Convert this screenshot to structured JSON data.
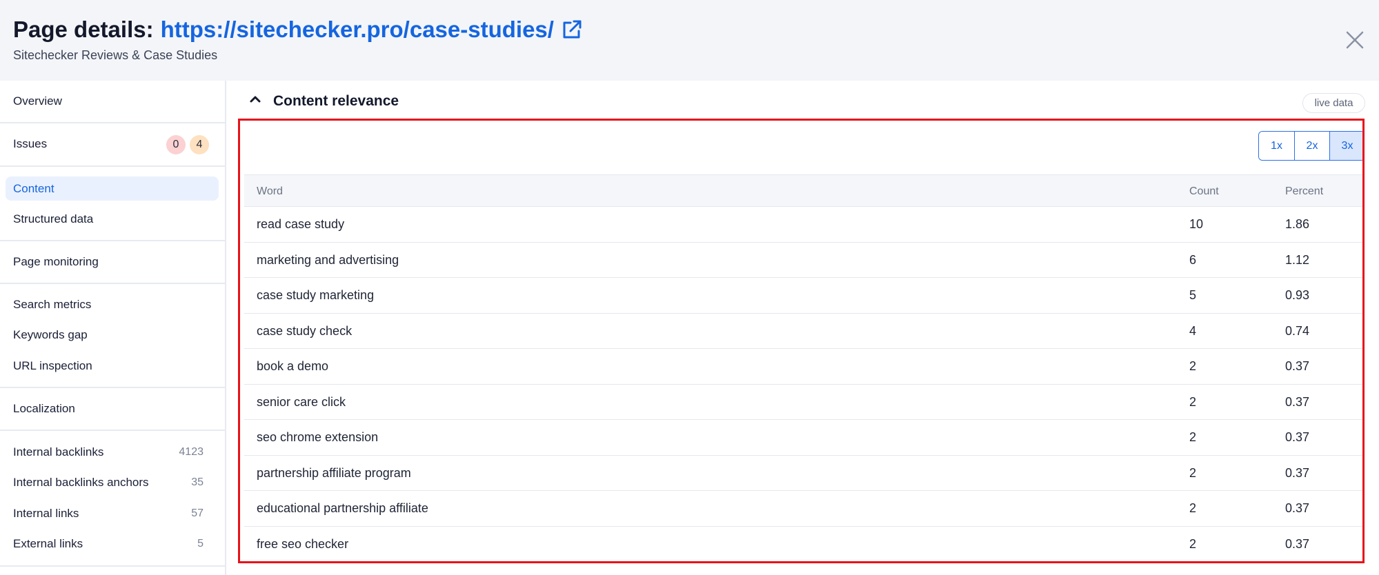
{
  "header": {
    "title_label": "Page details:",
    "url": "https://sitechecker.pro/case-studies/",
    "subtitle": "Sitechecker Reviews & Case Studies",
    "external_icon": "external-link-icon",
    "close_icon": "close-icon"
  },
  "sidebar": {
    "overview": "Overview",
    "issues": {
      "label": "Issues",
      "errors": "0",
      "warnings": "4"
    },
    "content": "Content",
    "structured_data": "Structured data",
    "page_monitoring": "Page monitoring",
    "search_metrics": "Search metrics",
    "keywords_gap": "Keywords gap",
    "url_inspection": "URL inspection",
    "localization": "Localization",
    "internal_backlinks": {
      "label": "Internal backlinks",
      "count": "4123"
    },
    "internal_backlinks_anchors": {
      "label": "Internal backlinks anchors",
      "count": "35"
    },
    "internal_links": {
      "label": "Internal links",
      "count": "57"
    },
    "external_links": {
      "label": "External links",
      "count": "5"
    }
  },
  "section": {
    "title": "Content relevance",
    "badge": "live data",
    "chevron_icon": "chevron-up-icon"
  },
  "ngram": {
    "options": [
      "1x",
      "2x",
      "3x"
    ],
    "selected": "3x"
  },
  "table": {
    "headers": {
      "word": "Word",
      "count": "Count",
      "percent": "Percent"
    },
    "rows": [
      {
        "word": "read case study",
        "count": "10",
        "percent": "1.86"
      },
      {
        "word": "marketing and advertising",
        "count": "6",
        "percent": "1.12"
      },
      {
        "word": "case study marketing",
        "count": "5",
        "percent": "0.93"
      },
      {
        "word": "case study check",
        "count": "4",
        "percent": "0.74"
      },
      {
        "word": "book a demo",
        "count": "2",
        "percent": "0.37"
      },
      {
        "word": "senior care click",
        "count": "2",
        "percent": "0.37"
      },
      {
        "word": "seo chrome extension",
        "count": "2",
        "percent": "0.37"
      },
      {
        "word": "partnership affiliate program",
        "count": "2",
        "percent": "0.37"
      },
      {
        "word": "educational partnership affiliate",
        "count": "2",
        "percent": "0.37"
      },
      {
        "word": "free seo checker",
        "count": "2",
        "percent": "0.37"
      }
    ]
  },
  "colors": {
    "accent": "#1565e0",
    "highlight_border": "#e8121b",
    "active_nav_bg": "#eaf1fe"
  }
}
